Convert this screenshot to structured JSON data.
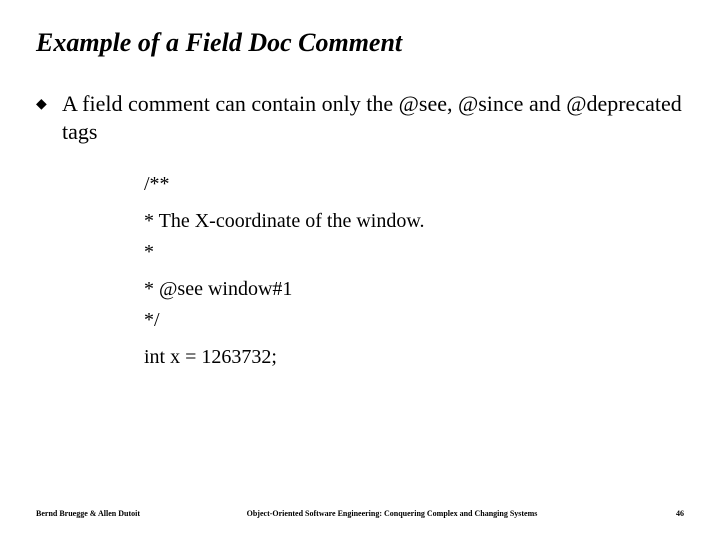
{
  "title": "Example of a Field Doc Comment",
  "bullet": {
    "mark": "◆",
    "text": "A field comment can contain only the @see, @since and @deprecated tags"
  },
  "code": {
    "l1": "/**",
    "l2": " * The X-coordinate of the window.",
    "l3": " *",
    "l4": " * @see window#1",
    "l5": " */",
    "l6": "int x = 1263732;"
  },
  "footer": {
    "left": "Bernd Bruegge & Allen Dutoit",
    "center": "Object-Oriented Software Engineering: Conquering Complex and Changing Systems",
    "right": "46"
  }
}
